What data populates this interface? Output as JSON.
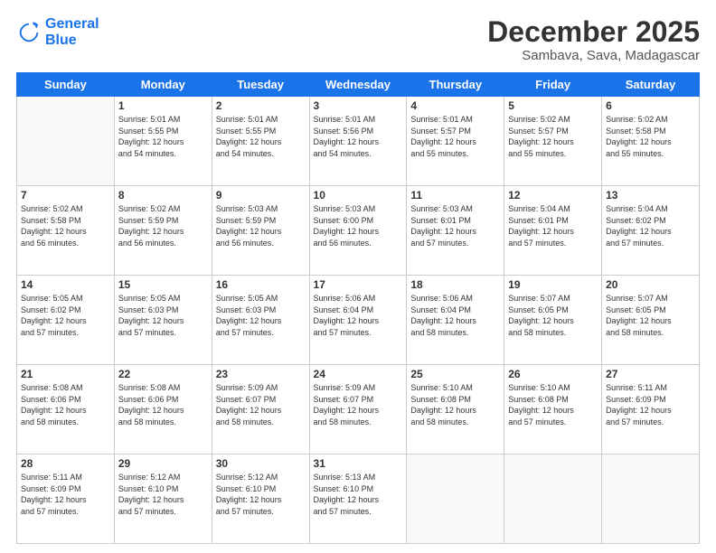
{
  "logo": {
    "line1": "General",
    "line2": "Blue"
  },
  "title": "December 2025",
  "subtitle": "Sambava, Sava, Madagascar",
  "days_of_week": [
    "Sunday",
    "Monday",
    "Tuesday",
    "Wednesday",
    "Thursday",
    "Friday",
    "Saturday"
  ],
  "weeks": [
    [
      {
        "day": "",
        "info": ""
      },
      {
        "day": "1",
        "info": "Sunrise: 5:01 AM\nSunset: 5:55 PM\nDaylight: 12 hours\nand 54 minutes."
      },
      {
        "day": "2",
        "info": "Sunrise: 5:01 AM\nSunset: 5:55 PM\nDaylight: 12 hours\nand 54 minutes."
      },
      {
        "day": "3",
        "info": "Sunrise: 5:01 AM\nSunset: 5:56 PM\nDaylight: 12 hours\nand 54 minutes."
      },
      {
        "day": "4",
        "info": "Sunrise: 5:01 AM\nSunset: 5:57 PM\nDaylight: 12 hours\nand 55 minutes."
      },
      {
        "day": "5",
        "info": "Sunrise: 5:02 AM\nSunset: 5:57 PM\nDaylight: 12 hours\nand 55 minutes."
      },
      {
        "day": "6",
        "info": "Sunrise: 5:02 AM\nSunset: 5:58 PM\nDaylight: 12 hours\nand 55 minutes."
      }
    ],
    [
      {
        "day": "7",
        "info": "Sunrise: 5:02 AM\nSunset: 5:58 PM\nDaylight: 12 hours\nand 56 minutes."
      },
      {
        "day": "8",
        "info": "Sunrise: 5:02 AM\nSunset: 5:59 PM\nDaylight: 12 hours\nand 56 minutes."
      },
      {
        "day": "9",
        "info": "Sunrise: 5:03 AM\nSunset: 5:59 PM\nDaylight: 12 hours\nand 56 minutes."
      },
      {
        "day": "10",
        "info": "Sunrise: 5:03 AM\nSunset: 6:00 PM\nDaylight: 12 hours\nand 56 minutes."
      },
      {
        "day": "11",
        "info": "Sunrise: 5:03 AM\nSunset: 6:01 PM\nDaylight: 12 hours\nand 57 minutes."
      },
      {
        "day": "12",
        "info": "Sunrise: 5:04 AM\nSunset: 6:01 PM\nDaylight: 12 hours\nand 57 minutes."
      },
      {
        "day": "13",
        "info": "Sunrise: 5:04 AM\nSunset: 6:02 PM\nDaylight: 12 hours\nand 57 minutes."
      }
    ],
    [
      {
        "day": "14",
        "info": "Sunrise: 5:05 AM\nSunset: 6:02 PM\nDaylight: 12 hours\nand 57 minutes."
      },
      {
        "day": "15",
        "info": "Sunrise: 5:05 AM\nSunset: 6:03 PM\nDaylight: 12 hours\nand 57 minutes."
      },
      {
        "day": "16",
        "info": "Sunrise: 5:05 AM\nSunset: 6:03 PM\nDaylight: 12 hours\nand 57 minutes."
      },
      {
        "day": "17",
        "info": "Sunrise: 5:06 AM\nSunset: 6:04 PM\nDaylight: 12 hours\nand 57 minutes."
      },
      {
        "day": "18",
        "info": "Sunrise: 5:06 AM\nSunset: 6:04 PM\nDaylight: 12 hours\nand 58 minutes."
      },
      {
        "day": "19",
        "info": "Sunrise: 5:07 AM\nSunset: 6:05 PM\nDaylight: 12 hours\nand 58 minutes."
      },
      {
        "day": "20",
        "info": "Sunrise: 5:07 AM\nSunset: 6:05 PM\nDaylight: 12 hours\nand 58 minutes."
      }
    ],
    [
      {
        "day": "21",
        "info": "Sunrise: 5:08 AM\nSunset: 6:06 PM\nDaylight: 12 hours\nand 58 minutes."
      },
      {
        "day": "22",
        "info": "Sunrise: 5:08 AM\nSunset: 6:06 PM\nDaylight: 12 hours\nand 58 minutes."
      },
      {
        "day": "23",
        "info": "Sunrise: 5:09 AM\nSunset: 6:07 PM\nDaylight: 12 hours\nand 58 minutes."
      },
      {
        "day": "24",
        "info": "Sunrise: 5:09 AM\nSunset: 6:07 PM\nDaylight: 12 hours\nand 58 minutes."
      },
      {
        "day": "25",
        "info": "Sunrise: 5:10 AM\nSunset: 6:08 PM\nDaylight: 12 hours\nand 58 minutes."
      },
      {
        "day": "26",
        "info": "Sunrise: 5:10 AM\nSunset: 6:08 PM\nDaylight: 12 hours\nand 57 minutes."
      },
      {
        "day": "27",
        "info": "Sunrise: 5:11 AM\nSunset: 6:09 PM\nDaylight: 12 hours\nand 57 minutes."
      }
    ],
    [
      {
        "day": "28",
        "info": "Sunrise: 5:11 AM\nSunset: 6:09 PM\nDaylight: 12 hours\nand 57 minutes."
      },
      {
        "day": "29",
        "info": "Sunrise: 5:12 AM\nSunset: 6:10 PM\nDaylight: 12 hours\nand 57 minutes."
      },
      {
        "day": "30",
        "info": "Sunrise: 5:12 AM\nSunset: 6:10 PM\nDaylight: 12 hours\nand 57 minutes."
      },
      {
        "day": "31",
        "info": "Sunrise: 5:13 AM\nSunset: 6:10 PM\nDaylight: 12 hours\nand 57 minutes."
      },
      {
        "day": "",
        "info": ""
      },
      {
        "day": "",
        "info": ""
      },
      {
        "day": "",
        "info": ""
      }
    ]
  ]
}
